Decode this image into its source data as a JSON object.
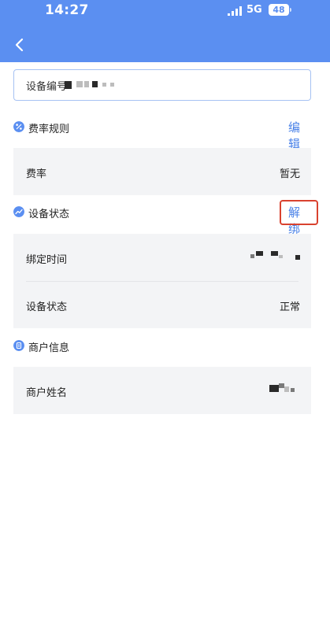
{
  "status_bar": {
    "time": "14:27",
    "network": "5G",
    "battery": "48"
  },
  "header": {
    "back_icon": "chevron-left-icon"
  },
  "device": {
    "label": "设备编号"
  },
  "sections": {
    "rate": {
      "title": "费率规则",
      "icon": "percent-icon",
      "action": "编辑",
      "rows": [
        {
          "label": "费率",
          "value": "暂无"
        }
      ]
    },
    "status": {
      "title": "设备状态",
      "icon": "trend-icon",
      "action": "解绑",
      "rows": [
        {
          "label": "绑定时间",
          "value": ""
        },
        {
          "label": "设备状态",
          "value": "正常"
        }
      ]
    },
    "merchant": {
      "title": "商户信息",
      "icon": "document-icon",
      "rows": [
        {
          "label": "商户姓名",
          "value": ""
        }
      ]
    }
  },
  "colors": {
    "header": "#5b8ff1",
    "accent": "#4a82e8",
    "highlight": "#d9422f",
    "card": "#f3f4f6"
  }
}
